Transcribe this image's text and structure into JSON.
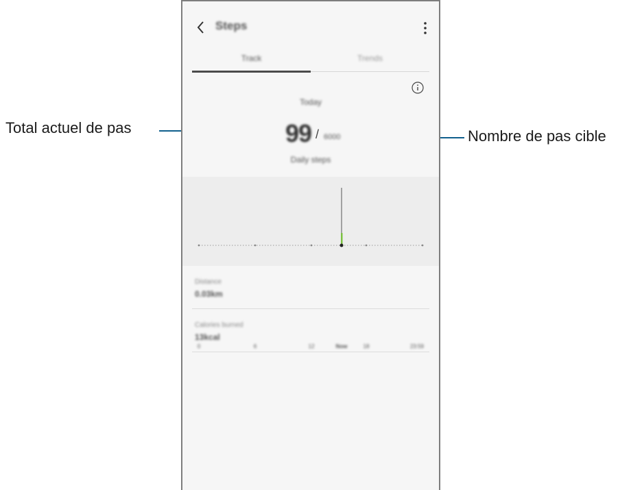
{
  "app": {
    "title": "Steps",
    "tabs": [
      {
        "label": "Track",
        "active": true
      },
      {
        "label": "Trends",
        "active": false
      }
    ]
  },
  "summary": {
    "period": "Today",
    "current_steps": "99",
    "separator": "/",
    "target_steps": "6000",
    "status": "Daily steps"
  },
  "chart_data": {
    "type": "bar",
    "x_tick_labels": [
      "0",
      "6",
      "12",
      "Now",
      "18",
      "23:59"
    ],
    "highlighted_label": "Now"
  },
  "stats": [
    {
      "label": "Distance",
      "value": "0.03km"
    },
    {
      "label": "Calories burned",
      "value": "13kcal"
    }
  ],
  "annotations": {
    "left": "Total actuel de pas",
    "right": "Nombre de pas cible"
  },
  "colors": {
    "annotation_line": "#0f5e8c",
    "step_bar": "#7dc243",
    "chart_bg": "#ededed"
  },
  "icons": [
    "back-arrow-icon",
    "more-vertical-icon",
    "info-icon"
  ]
}
